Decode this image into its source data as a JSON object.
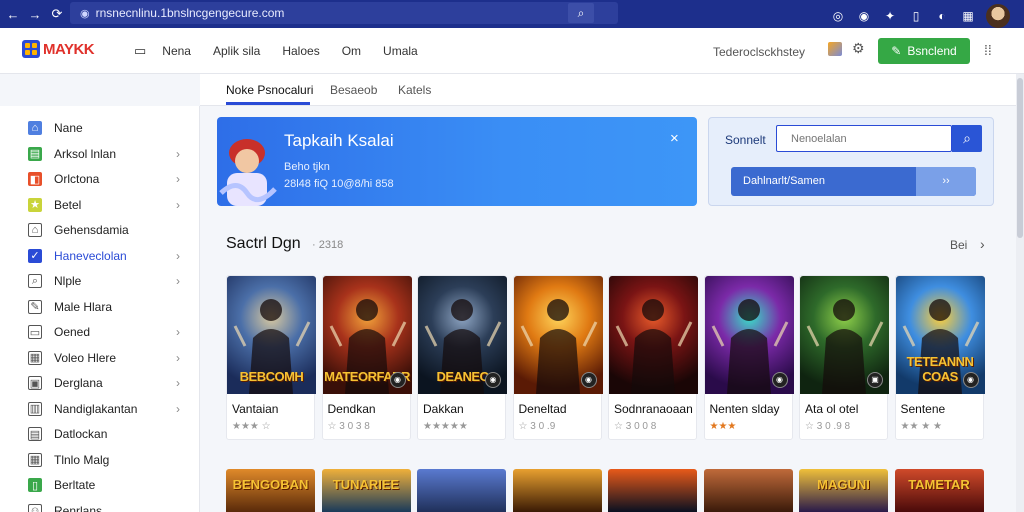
{
  "browser": {
    "url": "rnsnecnlinu.1bnslncgengecure.com",
    "icons": [
      "back-icon",
      "forward-icon",
      "reload-icon",
      "search-icon",
      "chrome-icon",
      "record-icon",
      "extension-icon",
      "copy-icon",
      "shield-icon",
      "grid-icon",
      "avatar"
    ]
  },
  "header": {
    "logo_text": "MAYKK",
    "nav": [
      "Nena",
      "Aplik sila",
      "Haloes",
      "Om",
      "Umala"
    ],
    "right_text": "Tederoclsckhstey",
    "download_label": "Bsnclend",
    "accent": "#35a845"
  },
  "subtabs": [
    "Noke Psnocaluri",
    "Besaeob",
    "Katels"
  ],
  "sidebar": {
    "items": [
      {
        "label": "Nane",
        "icon": "home-icon",
        "color": "#4f7fe0",
        "chevron": false,
        "active": false
      },
      {
        "label": "Arksol lnlan",
        "icon": "app-icon",
        "color": "#3aa84b",
        "chevron": true,
        "active": false
      },
      {
        "label": "Orlctona",
        "icon": "games-icon",
        "color": "#e8502a",
        "chevron": true,
        "active": false
      },
      {
        "label": "Betel",
        "icon": "star-icon",
        "color": "#c9d43a",
        "chevron": true,
        "active": false
      },
      {
        "label": "Gehensdamia",
        "icon": "house-icon",
        "color": "#555555",
        "chevron": false,
        "active": false
      },
      {
        "label": "Haneveclolan",
        "icon": "check-icon",
        "color": "#2a4bd6",
        "chevron": true,
        "active": true
      },
      {
        "label": "Nlple",
        "icon": "search-icon",
        "color": "#555555",
        "chevron": true,
        "active": false
      },
      {
        "label": "Male Hlara",
        "icon": "tag-icon",
        "color": "#555555",
        "chevron": false,
        "active": false
      },
      {
        "label": "Oened",
        "icon": "folder-icon",
        "color": "#555555",
        "chevron": true,
        "active": false
      },
      {
        "label": "Voleo Hlere",
        "icon": "video-icon",
        "color": "#555555",
        "chevron": true,
        "active": false
      },
      {
        "label": "Derglana",
        "icon": "bag-icon",
        "color": "#555555",
        "chevron": true,
        "active": false
      },
      {
        "label": "Nandiglakantan",
        "icon": "book-icon",
        "color": "#555555",
        "chevron": true,
        "active": false
      },
      {
        "label": "Datlockan",
        "icon": "list-icon",
        "color": "#555555",
        "chevron": false,
        "active": false
      },
      {
        "label": "Tlnlo Malg",
        "icon": "grid-icon",
        "color": "#555555",
        "chevron": false,
        "active": false
      },
      {
        "label": "Berltate",
        "icon": "phone-icon",
        "color": "#3aa84b",
        "chevron": false,
        "active": false
      },
      {
        "label": "Renrlans",
        "icon": "people-icon",
        "color": "#555555",
        "chevron": false,
        "active": false
      }
    ]
  },
  "banner": {
    "title": "Tapkaih Ksalai",
    "line1": "Beho tjkn",
    "line2": "28l48 fiQ 10@8/hi 858",
    "close": "×"
  },
  "search": {
    "label": "Sonnelt",
    "placeholder": "Nenoelalan",
    "button_label": "Dahlnarlt/Samen",
    "button_arrow": "››"
  },
  "section": {
    "title": "Sactrl Dgn",
    "count": "· 2318",
    "more": "Bei",
    "chevron": "›"
  },
  "cards": [
    {
      "name": "Vantaian",
      "rating": "★★★ ☆",
      "caption": "BEBCOMH",
      "badge": "",
      "theme": [
        "#1b2c5a",
        "#4b6fa8",
        "#d9c9a0"
      ],
      "rating_orange": false
    },
    {
      "name": "Dendkan",
      "rating": "☆ 3 0 3 8",
      "caption": "MATEORFARR",
      "badge": "◉",
      "theme": [
        "#3a0f08",
        "#a8321b",
        "#f2a23a"
      ],
      "rating_orange": false
    },
    {
      "name": "Dakkan",
      "rating": "★★★★★",
      "caption": "DEANEC",
      "badge": "◉",
      "theme": [
        "#0b1420",
        "#2c3e58",
        "#8fa6c4"
      ],
      "rating_orange": false
    },
    {
      "name": "Deneltad",
      "rating": "☆ 3 0 .9",
      "caption": "",
      "badge": "◉",
      "theme": [
        "#5a1a05",
        "#e07a13",
        "#ffd45a"
      ],
      "rating_orange": false
    },
    {
      "name": "Sodnranaoaan",
      "rating": "☆ 3 0 0 8",
      "caption": "",
      "badge": "",
      "theme": [
        "#1a0606",
        "#7a1414",
        "#e85a2a"
      ],
      "rating_orange": false
    },
    {
      "name": "Nenten slday",
      "rating": "★★★",
      "caption": "",
      "badge": "◉",
      "theme": [
        "#2a0b4a",
        "#7b2aa8",
        "#38e0c8"
      ],
      "rating_orange": true
    },
    {
      "name": "Ata ol otel",
      "rating": "☆ 3 0 .9 8",
      "caption": "",
      "badge": "▣",
      "theme": [
        "#0f2410",
        "#2e6a2a",
        "#8fd04a"
      ],
      "rating_orange": false
    },
    {
      "name": "Sentene",
      "rating": "★★ ★ ★",
      "caption": "TETEANNN COAS",
      "badge": "◉",
      "theme": [
        "#123a6a",
        "#3f8ee0",
        "#ffcf3a"
      ],
      "rating_orange": false
    }
  ],
  "peeks": [
    {
      "caption": "BENGOBAN",
      "theme": [
        "#5a2a0a",
        "#e08a2a"
      ]
    },
    {
      "caption": "TUNARIEE",
      "theme": [
        "#1a3a5a",
        "#f0b03a"
      ]
    },
    {
      "caption": "",
      "theme": [
        "#20305a",
        "#5a7ad0"
      ]
    },
    {
      "caption": "",
      "theme": [
        "#3a1a05",
        "#e8a030"
      ]
    },
    {
      "caption": "",
      "theme": [
        "#0a1020",
        "#e85a1a"
      ]
    },
    {
      "caption": "",
      "theme": [
        "#3a1a0a",
        "#c06a3a"
      ]
    },
    {
      "caption": "MAGUNI",
      "theme": [
        "#2a1a4a",
        "#f0c03a"
      ]
    },
    {
      "caption": "TAMETAR",
      "theme": [
        "#4a0a0a",
        "#d04a2a"
      ]
    }
  ]
}
